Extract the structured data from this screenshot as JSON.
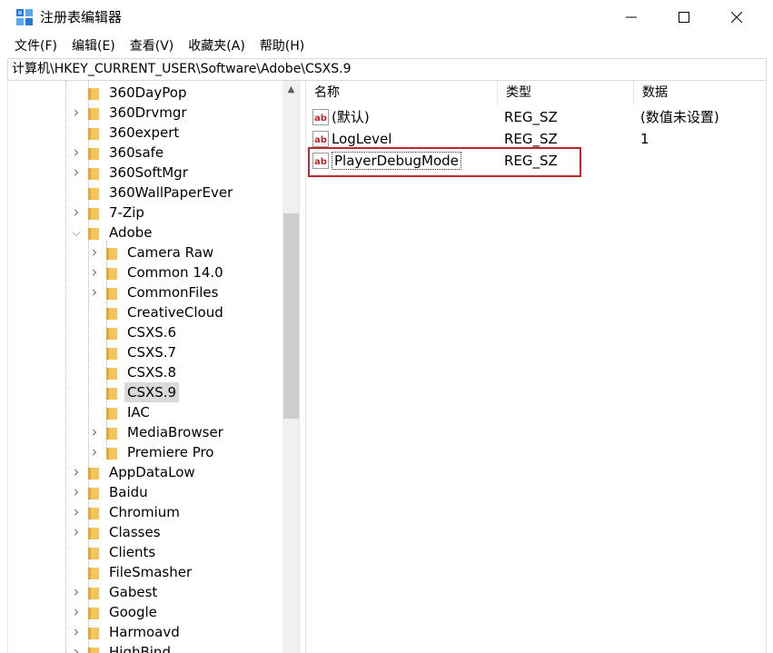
{
  "window": {
    "title": "注册表编辑器",
    "app_icon": "regedit-icon"
  },
  "menu": [
    "文件(F)",
    "编辑(E)",
    "查看(V)",
    "收藏夹(A)",
    "帮助(H)"
  ],
  "address": "计算机\\HKEY_CURRENT_USER\\Software\\Adobe\\CSXS.9",
  "tree": [
    {
      "label": "360DayPop",
      "depth": 1,
      "expandable": false
    },
    {
      "label": "360Drvmgr",
      "depth": 1,
      "expandable": true
    },
    {
      "label": "360expert",
      "depth": 1,
      "expandable": false
    },
    {
      "label": "360safe",
      "depth": 1,
      "expandable": true
    },
    {
      "label": "360SoftMgr",
      "depth": 1,
      "expandable": true
    },
    {
      "label": "360WallPaperEver",
      "depth": 1,
      "expandable": false
    },
    {
      "label": "7-Zip",
      "depth": 1,
      "expandable": true
    },
    {
      "label": "Adobe",
      "depth": 1,
      "expandable": true,
      "expanded": true
    },
    {
      "label": "Camera Raw",
      "depth": 2,
      "expandable": true
    },
    {
      "label": "Common 14.0",
      "depth": 2,
      "expandable": true
    },
    {
      "label": "CommonFiles",
      "depth": 2,
      "expandable": true
    },
    {
      "label": "CreativeCloud",
      "depth": 2,
      "expandable": false
    },
    {
      "label": "CSXS.6",
      "depth": 2,
      "expandable": false
    },
    {
      "label": "CSXS.7",
      "depth": 2,
      "expandable": false
    },
    {
      "label": "CSXS.8",
      "depth": 2,
      "expandable": false
    },
    {
      "label": "CSXS.9",
      "depth": 2,
      "expandable": false,
      "selected": true
    },
    {
      "label": "IAC",
      "depth": 2,
      "expandable": false
    },
    {
      "label": "MediaBrowser",
      "depth": 2,
      "expandable": true
    },
    {
      "label": "Premiere Pro",
      "depth": 2,
      "expandable": true
    },
    {
      "label": "AppDataLow",
      "depth": 1,
      "expandable": true
    },
    {
      "label": "Baidu",
      "depth": 1,
      "expandable": true
    },
    {
      "label": "Chromium",
      "depth": 1,
      "expandable": true
    },
    {
      "label": "Classes",
      "depth": 1,
      "expandable": true
    },
    {
      "label": "Clients",
      "depth": 1,
      "expandable": false
    },
    {
      "label": "FileSmasher",
      "depth": 1,
      "expandable": false
    },
    {
      "label": "Gabest",
      "depth": 1,
      "expandable": true
    },
    {
      "label": "Google",
      "depth": 1,
      "expandable": true
    },
    {
      "label": "Harmoavd",
      "depth": 1,
      "expandable": true
    },
    {
      "label": "HighBind",
      "depth": 1,
      "expandable": true
    }
  ],
  "list": {
    "columns": [
      "名称",
      "类型",
      "数据"
    ],
    "rows": [
      {
        "name": "(默认)",
        "type": "REG_SZ",
        "data": "(数值未设置)",
        "icon": "string-value-icon"
      },
      {
        "name": "LogLevel",
        "type": "REG_SZ",
        "data": "1",
        "icon": "string-value-icon"
      },
      {
        "name": "PlayerDebugMode",
        "type": "REG_SZ",
        "data": "",
        "icon": "string-value-icon",
        "focused": true
      }
    ]
  },
  "colors": {
    "highlight_border": "#c0262d",
    "folder": "#f4c55a",
    "selection": "#d9d9d9"
  }
}
